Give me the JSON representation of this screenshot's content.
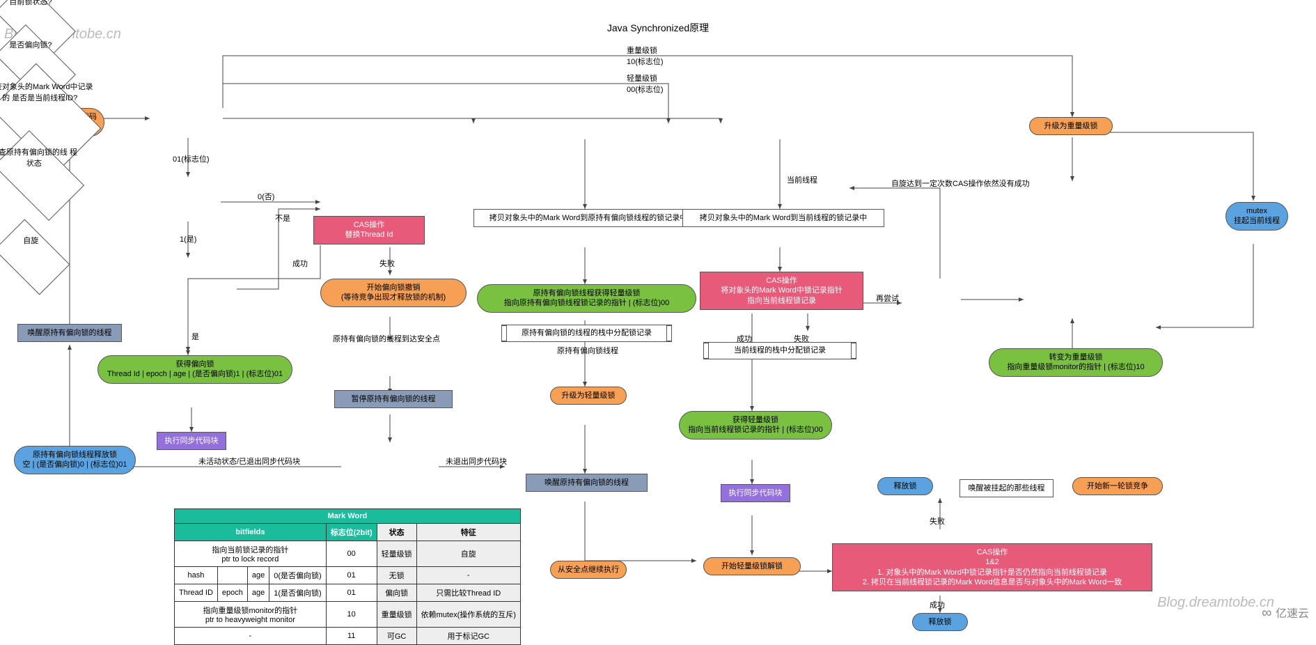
{
  "title": "Java Synchronized原理",
  "wm": "Blog.dreamtobe.cn",
  "logo": "亿速云",
  "n": {
    "start": "线程访问同步代码块",
    "d_state": "目前锁状态?",
    "l_heavy": "重量级锁",
    "l_heavyb": "10(标志位)",
    "l_light": "轻量级锁",
    "l_lightb": "00(标志位)",
    "l_01": "01(标志位)",
    "d_bias": "是否偏向锁?",
    "l_0": "0(否)",
    "l_1": "1(是)",
    "d_markid": "检查对象头的Mark Word中记录的\n是否是当前线程ID?",
    "l_no": "不是",
    "l_yes": "是",
    "cas1_t": "CAS操作",
    "cas1_b": "替换Thread Id",
    "l_succ": "成功",
    "l_fail": "失败",
    "get_bias_t": "获得偏向锁",
    "get_bias_b": "Thread Id | epoch | age | (是否偏向锁)1 | (标志位)01",
    "exec_sync": "执行同步代码块",
    "revoke_t": "开始偏向锁撤销",
    "revoke_b": "(等待竞争出现才释放锁的机制)",
    "safe": "原持有偏向锁的线程到达安全点",
    "pause": "暂停原持有偏向锁的线程",
    "d_check": "检查原持有偏向锁的线\n程状态",
    "l_exit": "未活动状态/已退出同步代码块",
    "l_noexit": "未退出同步代码块",
    "release_t": "原持有偏向锁线程释放锁",
    "release_b": "空 | (是否偏向锁)0 | (标志位)01",
    "wake_orig": "唤醒原持有偏向锁的线程",
    "p1": "原持有偏向锁的线程的栈中分配锁记录",
    "p2": "拷贝对象头中的Mark Word到原持有偏向锁线程的锁记录中",
    "gl_t": "原持有偏向锁线程获得轻量级锁",
    "gl_b": "指向原持有偏向锁线程锁记录的指针 | (标志位)00",
    "l_origthread": "原持有偏向锁线程",
    "up_light": "升级为轻量级锁",
    "wake2": "唤醒原持有偏向锁的线程",
    "cont": "从安全点继续执行",
    "p3": "当前线程的栈中分配锁记录",
    "l_cur": "当前线程",
    "p4": "拷贝对象头中的Mark Word到当前线程的锁记录中",
    "cas2_t": "CAS操作",
    "cas2_b": "将对象头的Mark Word中锁记录指针\n指向当前线程锁记录",
    "d_spin": "自旋",
    "l_retry": "再尝试",
    "l_spinfail": "自旋达到一定次数CAS操作依然没有成功",
    "up_heavy": "升级为重量级锁",
    "gll_t": "获得轻量级锁",
    "gll_b": "指向当前线程锁记录的指针 | (标志位)00",
    "exec2": "执行同步代码块",
    "unlock_start": "开始轻量级锁解锁",
    "cas3_t": "CAS操作",
    "cas3_m": "1&2",
    "cas3_1": "1. 对象头中的Mark Word中锁记录指针是否仍然指向当前线程锁记录",
    "cas3_2": "2. 拷贝在当前线程锁记录的Mark Word信息是否与对象头中的Mark Word一致",
    "rel_lock": "释放锁",
    "rel_lock2": "释放锁",
    "wake3": "唤醒被挂起的那些线程",
    "new_comp": "开始新一轮锁竞争",
    "toheavy_t": "转变为重量级锁",
    "toheavy_b": "指向重量级锁monitor的指针 | (标志位)10",
    "mutex_t": "mutex",
    "mutex_b": "挂起当前线程"
  },
  "tbl": {
    "cap": "Mark Word",
    "h1": "bitfields",
    "h2": "标志位(2bit)",
    "h3": "状态",
    "h4": "特征",
    "r": [
      [
        "指向当前锁记录的指针\nptr to lock record",
        "",
        "",
        "",
        "00",
        "轻量级锁",
        "自旋"
      ],
      [
        "hash",
        "",
        "age",
        "0(是否偏向锁)",
        "01",
        "无锁",
        "-"
      ],
      [
        "Thread ID",
        "epoch",
        "age",
        "1(是否偏向锁)",
        "01",
        "偏向锁",
        "只需比较Thread ID"
      ],
      [
        "指向重量级锁monitor的指针\nptr to heavyweight monitor",
        "",
        "",
        "",
        "10",
        "重量级锁",
        "依赖mutex(操作系统的互斥)"
      ],
      [
        "-",
        "",
        "",
        "",
        "11",
        "可GC",
        "用于标记GC"
      ]
    ]
  }
}
